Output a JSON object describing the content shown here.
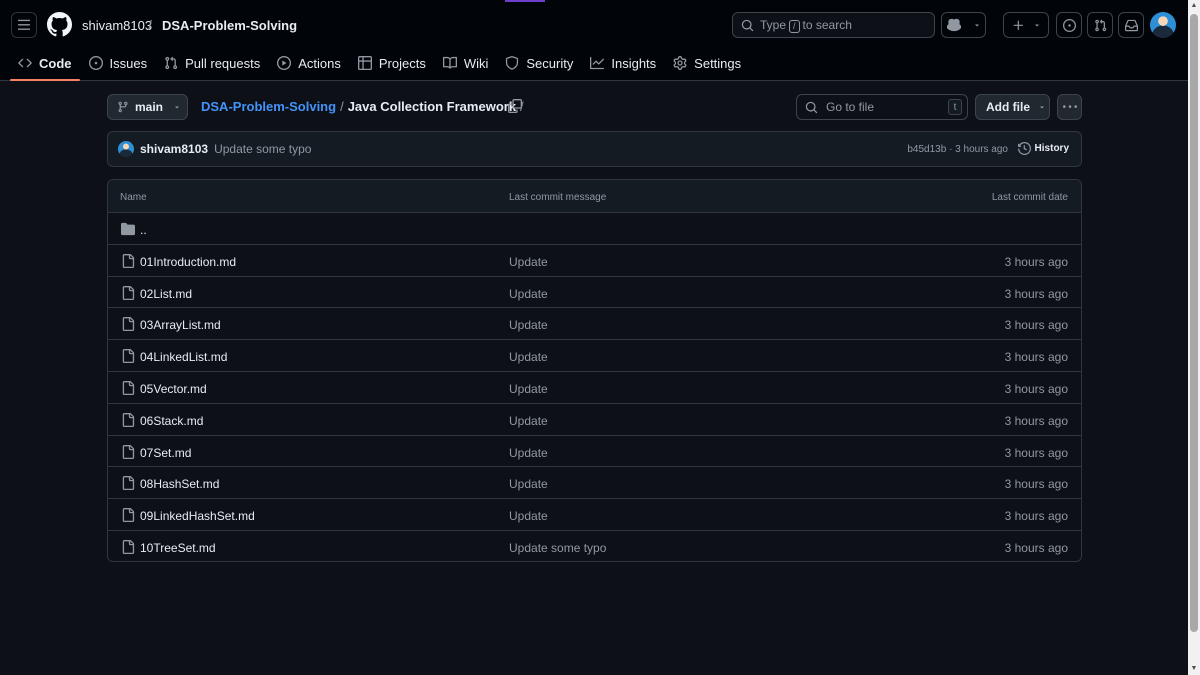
{
  "header": {
    "owner": "shivam8103",
    "separator": "/",
    "repo": "DSA-Problem-Solving",
    "search": {
      "prefix": "Type",
      "key": "/",
      "suffix": "to search"
    }
  },
  "nav": {
    "items": [
      {
        "label": "Code",
        "icon": "code-icon",
        "active": true
      },
      {
        "label": "Issues",
        "icon": "issue-icon"
      },
      {
        "label": "Pull requests",
        "icon": "pull-request-icon"
      },
      {
        "label": "Actions",
        "icon": "play-icon"
      },
      {
        "label": "Projects",
        "icon": "table-icon"
      },
      {
        "label": "Wiki",
        "icon": "book-icon"
      },
      {
        "label": "Security",
        "icon": "shield-icon"
      },
      {
        "label": "Insights",
        "icon": "graph-icon"
      },
      {
        "label": "Settings",
        "icon": "gear-icon"
      }
    ]
  },
  "toolbar": {
    "branch": "main",
    "path_repo": "DSA-Problem-Solving",
    "path_sep": "/",
    "path_dir": "Java Collection Framework",
    "path_trail": "/",
    "goto_placeholder": "Go to file",
    "goto_key": "t",
    "add_file": "Add file"
  },
  "commit": {
    "author": "shivam8103",
    "message": "Update some typo",
    "meta": "b45d13b · 3 hours ago",
    "history": "History"
  },
  "table": {
    "headers": {
      "name": "Name",
      "message": "Last commit message",
      "date": "Last commit date"
    },
    "parent": "..",
    "rows": [
      {
        "name": "01Introduction.md",
        "message": "Update",
        "date": "3 hours ago"
      },
      {
        "name": "02List.md",
        "message": "Update",
        "date": "3 hours ago"
      },
      {
        "name": "03ArrayList.md",
        "message": "Update",
        "date": "3 hours ago"
      },
      {
        "name": "04LinkedList.md",
        "message": "Update",
        "date": "3 hours ago"
      },
      {
        "name": "05Vector.md",
        "message": "Update",
        "date": "3 hours ago"
      },
      {
        "name": "06Stack.md",
        "message": "Update",
        "date": "3 hours ago"
      },
      {
        "name": "07Set.md",
        "message": "Update",
        "date": "3 hours ago"
      },
      {
        "name": "08HashSet.md",
        "message": "Update",
        "date": "3 hours ago"
      },
      {
        "name": "09LinkedHashSet.md",
        "message": "Update",
        "date": "3 hours ago"
      },
      {
        "name": "10TreeSet.md",
        "message": "Update some typo",
        "date": "3 hours ago"
      }
    ]
  },
  "colors": {
    "background": "#0d1117",
    "header": "#010409",
    "accent_link": "#4493f8",
    "active_tab": "#f78166",
    "border": "#30363d"
  }
}
